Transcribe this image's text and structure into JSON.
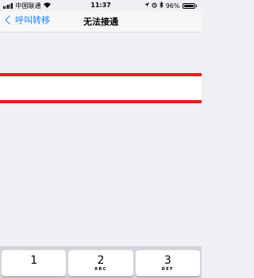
{
  "status_bar": {
    "carrier": "中国联通",
    "time": "11:37",
    "battery": "96%",
    "battery_level": 0.96
  },
  "nav": {
    "back_label": "呼叫转移",
    "title": "无法接通"
  },
  "input": {
    "value": "",
    "placeholder": ""
  },
  "keypad": {
    "keys": [
      {
        "digit": "1",
        "letters": ""
      },
      {
        "digit": "2",
        "letters": "ABC"
      },
      {
        "digit": "3",
        "letters": "DEF"
      }
    ]
  },
  "colors": {
    "accent": "#1a82fb",
    "highlight": "#e81c1c",
    "background": "#efeff4"
  }
}
